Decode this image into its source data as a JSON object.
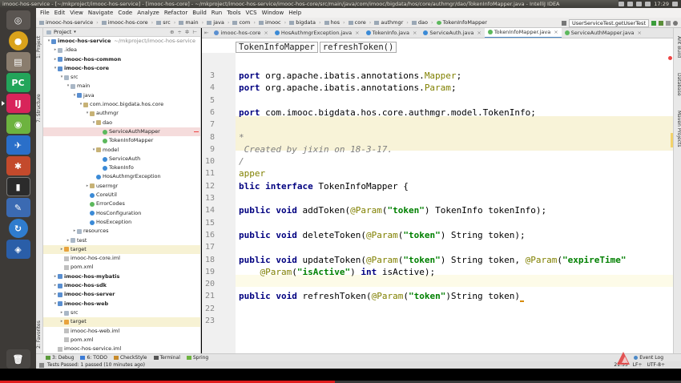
{
  "window": {
    "title": "imooc-hos-service - [~/mkproject/imooc-hos-service] - [imooc-hos-core] - ~/mkproject/imooc-hos-service/imooc-hos-core/src/main/java/com/imooc/bigdata/hos/core/authmgr/dao/TokenInfoMapper.java - IntelliJ IDEA"
  },
  "system": {
    "time": "17:29"
  },
  "menu": [
    "File",
    "Edit",
    "View",
    "Navigate",
    "Code",
    "Analyze",
    "Refactor",
    "Build",
    "Run",
    "Tools",
    "VCS",
    "Window",
    "Help"
  ],
  "breadcrumb": [
    "imooc-hos-service",
    "imooc-hos-core",
    "src",
    "main",
    "java",
    "com",
    "imooc",
    "bigdata",
    "hos",
    "core",
    "authmgr",
    "dao",
    "TokenInfoMapper"
  ],
  "run_config": "UserServiceTest.getUserTest",
  "left_tool_tabs": [
    "1: Project",
    "7: Structure",
    "2: Favorites"
  ],
  "right_tool_tabs": [
    "Ant Build",
    "Database",
    "Maven Projects"
  ],
  "project": {
    "header": "Project",
    "tree": [
      {
        "label": "imooc-hos-service",
        "extra": "~/mkproject/imooc-hos-service",
        "indent": 0,
        "arrow": "▾",
        "icon": "f-blue",
        "bold": true
      },
      {
        "label": ".idea",
        "indent": 1,
        "arrow": "▸",
        "icon": "f-folder"
      },
      {
        "label": "imooc-hos-common",
        "indent": 1,
        "arrow": "▸",
        "icon": "f-blue",
        "bold": true
      },
      {
        "label": "imooc-hos-core",
        "indent": 1,
        "arrow": "▾",
        "icon": "f-blue",
        "bold": true
      },
      {
        "label": "src",
        "indent": 2,
        "arrow": "▾",
        "icon": "f-folder"
      },
      {
        "label": "main",
        "indent": 3,
        "arrow": "▾",
        "icon": "f-folder"
      },
      {
        "label": "java",
        "indent": 4,
        "arrow": "▾",
        "icon": "f-blue"
      },
      {
        "label": "com.imooc.bigdata.hos.core",
        "indent": 5,
        "arrow": "▾",
        "icon": "f-pkg"
      },
      {
        "label": "authmgr",
        "indent": 6,
        "arrow": "▾",
        "icon": "f-pkg"
      },
      {
        "label": "dao",
        "indent": 7,
        "arrow": "▾",
        "icon": "f-pkg"
      },
      {
        "label": "ServiceAuthMapper",
        "indent": 8,
        "arrow": "",
        "icon": "f-int",
        "sel": true
      },
      {
        "label": "TokenInfoMapper",
        "indent": 8,
        "arrow": "",
        "icon": "f-int"
      },
      {
        "label": "model",
        "indent": 7,
        "arrow": "▾",
        "icon": "f-pkg"
      },
      {
        "label": "ServiceAuth",
        "indent": 8,
        "arrow": "",
        "icon": "f-class"
      },
      {
        "label": "TokenInfo",
        "indent": 8,
        "arrow": "",
        "icon": "f-class"
      },
      {
        "label": "HosAuthmgrException",
        "indent": 7,
        "arrow": "",
        "icon": "f-class"
      },
      {
        "label": "usermgr",
        "indent": 6,
        "arrow": "▸",
        "icon": "f-pkg"
      },
      {
        "label": "CoreUtil",
        "indent": 6,
        "arrow": "",
        "icon": "f-class"
      },
      {
        "label": "ErrorCodes",
        "indent": 6,
        "arrow": "",
        "icon": "f-int"
      },
      {
        "label": "HosConfiguration",
        "indent": 6,
        "arrow": "",
        "icon": "f-class"
      },
      {
        "label": "HosException",
        "indent": 6,
        "arrow": "",
        "icon": "f-class"
      },
      {
        "label": "resources",
        "indent": 4,
        "arrow": "▸",
        "icon": "f-folder"
      },
      {
        "label": "test",
        "indent": 3,
        "arrow": "▸",
        "icon": "f-folder"
      },
      {
        "label": "target",
        "indent": 2,
        "arrow": "▸",
        "icon": "f-orange",
        "hl": true
      },
      {
        "label": "imooc-hos-core.iml",
        "indent": 2,
        "arrow": "",
        "icon": "f-file"
      },
      {
        "label": "pom.xml",
        "indent": 2,
        "arrow": "",
        "icon": "f-file"
      },
      {
        "label": "imooc-hos-mybatis",
        "indent": 1,
        "arrow": "▸",
        "icon": "f-blue",
        "bold": true
      },
      {
        "label": "imooc-hos-sdk",
        "indent": 1,
        "arrow": "▸",
        "icon": "f-blue",
        "bold": true
      },
      {
        "label": "imooc-hos-server",
        "indent": 1,
        "arrow": "▸",
        "icon": "f-blue",
        "bold": true
      },
      {
        "label": "imooc-hos-web",
        "indent": 1,
        "arrow": "▾",
        "icon": "f-blue",
        "bold": true
      },
      {
        "label": "src",
        "indent": 2,
        "arrow": "▸",
        "icon": "f-folder"
      },
      {
        "label": "target",
        "indent": 2,
        "arrow": "▸",
        "icon": "f-orange",
        "hl": true
      },
      {
        "label": "imooc-hos-web.iml",
        "indent": 2,
        "arrow": "",
        "icon": "f-file"
      },
      {
        "label": "pom.xml",
        "indent": 2,
        "arrow": "",
        "icon": "f-file"
      },
      {
        "label": "imooc-hos-service.iml",
        "indent": 1,
        "arrow": "",
        "icon": "f-file"
      }
    ]
  },
  "editor_tabs": [
    {
      "label": "imooc-hos-core",
      "color": "#5a8fd0"
    },
    {
      "label": "HosAuthmgrException.java",
      "color": "#3b8ad6"
    },
    {
      "label": "TokenInfo.java",
      "color": "#3b8ad6"
    },
    {
      "label": "ServiceAuth.java",
      "color": "#3b8ad6"
    },
    {
      "label": "TokenInfoMapper.java",
      "color": "#5cb85c",
      "active": true
    },
    {
      "label": "ServiceAuthMapper.java",
      "color": "#5cb85c"
    }
  ],
  "code_breadcrumb": [
    "TokenInfoMapper",
    "refreshToken()"
  ],
  "code_lines": [
    {
      "n": "3",
      "html": "<span class=\"kw\">port</span> org.apache.ibatis.annotations.<span class=\"an\">Mapper</span>;"
    },
    {
      "n": "4",
      "html": "<span class=\"kw\">port</span> org.apache.ibatis.annotations.<span class=\"an\">Param</span>;"
    },
    {
      "n": "5",
      "html": ""
    },
    {
      "n": "6",
      "html": "<span class=\"kw\">port</span> com.imooc.bigdata.hos.core.authmgr.model.TokenInfo;"
    },
    {
      "n": "7",
      "html": ""
    },
    {
      "n": "8",
      "html": "<span class=\"cm\">*</span>"
    },
    {
      "n": "9",
      "html": "<span class=\"cm\"> Created by jixin on 18-3-17.</span>"
    },
    {
      "n": "10",
      "html": "<span class=\"cm\">/</span>"
    },
    {
      "n": "11",
      "html": "<span class=\"an\">apper</span>"
    },
    {
      "n": "12",
      "html": "<span class=\"kw\">blic interface</span> TokenInfoMapper {"
    },
    {
      "n": "13",
      "html": ""
    },
    {
      "n": "14",
      "html": "<span class=\"kw\">public void</span> addToken(<span class=\"an\">@Param</span>(<span class=\"st\">\"token\"</span>) TokenInfo tokenInfo);"
    },
    {
      "n": "15",
      "html": ""
    },
    {
      "n": "16",
      "html": "<span class=\"kw\">public void</span> deleteToken(<span class=\"an\">@Param</span>(<span class=\"st\">\"token\"</span>) String token);"
    },
    {
      "n": "17",
      "html": ""
    },
    {
      "n": "18",
      "html": "<span class=\"kw\">public void</span> updateToken(<span class=\"an\">@Param</span>(<span class=\"st\">\"token\"</span>) String token, <span class=\"an\">@Param</span>(<span class=\"st\">\"expireTime\"</span>"
    },
    {
      "n": "19",
      "html": "    <span class=\"an\">@Param</span>(<span class=\"st\">\"isActive\"</span>) <span class=\"kw\">int</span> isActive);"
    },
    {
      "n": "20",
      "html": ""
    },
    {
      "n": "21",
      "html": "<span class=\"kw\">public void</span> refreshToken(<span class=\"an\">@Param</span>(<span class=\"st\">\"token\"</span>)String token)<span class=\"caret\"></span>"
    },
    {
      "n": "22",
      "html": ""
    },
    {
      "n": "23",
      "html": ""
    }
  ],
  "bottom_tabs": [
    "3: Debug",
    "6: TODO",
    "CheckStyle",
    "Terminal",
    "Spring"
  ],
  "event_log": "Event Log",
  "status": {
    "message": "Tests Passed: 1 passed (10 minutes ago)",
    "position": "21:55",
    "line_sep": "LF÷",
    "encoding": "UTF-8÷"
  },
  "colors": {
    "accent": "#4a88c7",
    "keyword": "#000080",
    "string": "#008000",
    "annotation": "#808000"
  }
}
